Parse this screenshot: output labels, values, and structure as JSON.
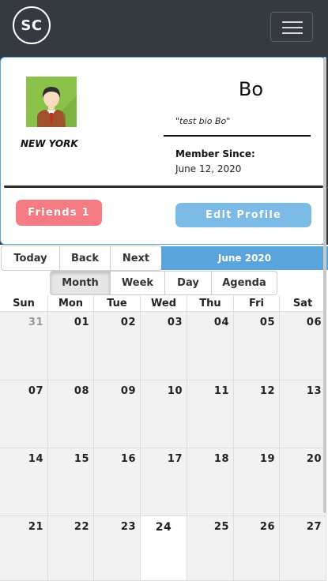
{
  "navbar": {
    "logo_text": "SC",
    "menu_icon": "hamburger-menu-icon"
  },
  "profile": {
    "avatar_icon": "user-avatar-icon",
    "location": "NEW YORK",
    "username": "Bo",
    "bio": "\"test bio Bo\"",
    "member_since_label": "Member Since:",
    "member_since_date": "June 12, 2020",
    "friends_button": "Friends 1",
    "edit_profile_button": "Edit Profile"
  },
  "calendar": {
    "nav": {
      "today": "Today",
      "back": "Back",
      "next": "Next"
    },
    "month_label": "June 2020",
    "views": [
      "Month",
      "Week",
      "Day",
      "Agenda"
    ],
    "active_view": "Month",
    "weekdays": [
      "Sun",
      "Mon",
      "Tue",
      "Wed",
      "Thu",
      "Fri",
      "Sat"
    ],
    "weeks": [
      [
        "31",
        "01",
        "02",
        "03",
        "04",
        "05",
        "06"
      ],
      [
        "07",
        "08",
        "09",
        "10",
        "11",
        "12",
        "13"
      ],
      [
        "14",
        "15",
        "16",
        "17",
        "18",
        "19",
        "20"
      ],
      [
        "21",
        "22",
        "23",
        "24",
        "25",
        "26",
        "27"
      ]
    ],
    "off_range_day": "31",
    "today_day": "24"
  },
  "colors": {
    "navbar": "#343a40",
    "accent_blue": "#5aa4dc",
    "friends_button": "#f57c83",
    "edit_button": "#7cbbe5"
  }
}
